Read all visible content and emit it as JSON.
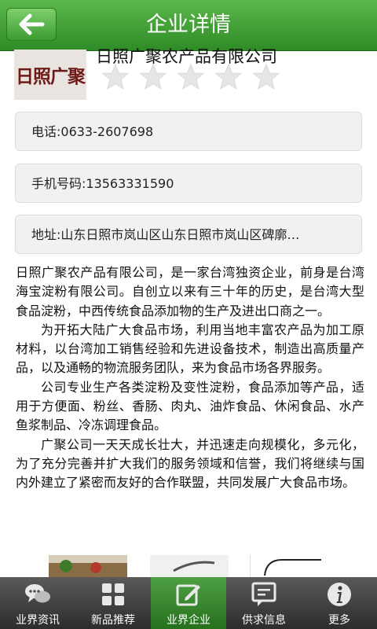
{
  "header": {
    "title": "企业详情"
  },
  "company": {
    "logo_text": "日照广聚",
    "name": "日照广聚农产品有限公司",
    "rating": 0,
    "rating_max": 5
  },
  "info": {
    "phone": "电话:0633-2607698",
    "mobile": "手机号码:13563331590",
    "address": "地址:山东日照市岚山区山东日照市岚山区碑廓…"
  },
  "description": [
    "日照广聚农产品有限公司，是一家台湾独资企业，前身是台湾海宝淀粉有限公司。自创立以来有三十年的历史，是台湾大型食品淀粉，中西传统食品添加物的生产及进出口商之一。",
    "为开拓大陆广大食品市场，利用当地丰富农产品为加工原材料，以台湾加工销售经验和先进设备技术，制造出高质量产品，以及通畅的物流服务团队，来为食品市场各界服务。",
    "公司专业生产各类淀粉及变性淀粉，食品添加等产品，适用于方便面、粉丝、香肠、肉丸、油炸食品、休闲食品、水产鱼浆制品、冷冻调理食品。",
    "广聚公司一天天成长壮大，并迅速走向规模化，多元化，为了充分完善并扩大我们的服务领域和信誉，我们将继续与国内外建立了紧密而友好的合作联盟，共同发展广大食品市场。"
  ],
  "tabs": [
    {
      "label": "业界资讯",
      "icon": "chat-bubbles-icon"
    },
    {
      "label": "新品推荐",
      "icon": "grid-icon"
    },
    {
      "label": "业界企业",
      "icon": "edit-icon",
      "active": true
    },
    {
      "label": "供求信息",
      "icon": "message-icon"
    },
    {
      "label": "更多",
      "icon": "info-icon"
    }
  ],
  "colors": {
    "header": "#3a9a2f",
    "tabbar": "#3c3c3c",
    "active_tab": "#3a8a30"
  }
}
